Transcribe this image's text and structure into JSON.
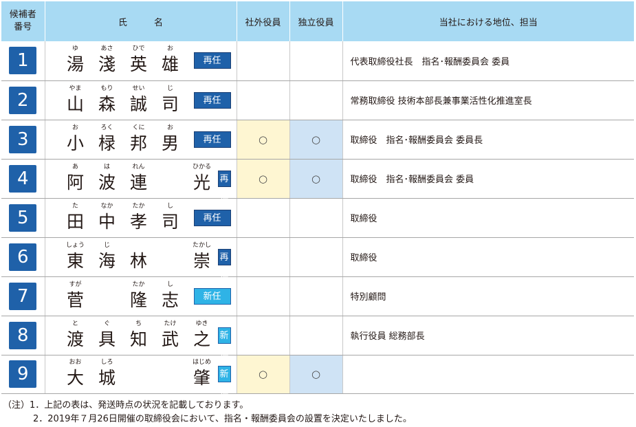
{
  "header": {
    "number_line1": "候補者",
    "number_line2": "番号",
    "name": "氏　　　名",
    "outside": "社外役員",
    "independent": "独立役員",
    "position": "当社における地位、担当"
  },
  "mark_symbol": "○",
  "colors": {
    "header_bg": "#a8daf3",
    "number_box": "#1f61a9",
    "badge_reappoint": "#1f61a9",
    "badge_new": "#2fb3e6",
    "outside_mark_bg": "#fef6d2",
    "independent_mark_bg": "#cfe3f5"
  },
  "candidates": [
    {
      "number": "1",
      "chars": [
        {
          "k": "湯",
          "r": "ゆ"
        },
        {
          "k": "淺",
          "r": "あさ"
        },
        {
          "k": "英",
          "r": "ひで"
        },
        {
          "k": "雄",
          "r": "お"
        }
      ],
      "badge": "再任",
      "badge_type": "re",
      "outside": false,
      "independent": false,
      "position": "代表取締役社長　指名･報酬委員会 委員"
    },
    {
      "number": "2",
      "chars": [
        {
          "k": "山",
          "r": "やま"
        },
        {
          "k": "森",
          "r": "もり"
        },
        {
          "k": "誠",
          "r": "せい"
        },
        {
          "k": "司",
          "r": "じ"
        }
      ],
      "badge": "再任",
      "badge_type": "re",
      "outside": false,
      "independent": false,
      "position": "常務取締役 技術本部長兼事業活性化推進室長"
    },
    {
      "number": "3",
      "chars": [
        {
          "k": "小",
          "r": "お"
        },
        {
          "k": "椂",
          "r": "ろく"
        },
        {
          "k": "邦",
          "r": "くに"
        },
        {
          "k": "男",
          "r": "お"
        }
      ],
      "badge": "再任",
      "badge_type": "re",
      "outside": true,
      "independent": true,
      "position": "取締役　指名･報酬委員会 委員長"
    },
    {
      "number": "4",
      "chars": [
        {
          "k": "阿",
          "r": "あ"
        },
        {
          "k": "波",
          "r": "は"
        },
        {
          "k": "連",
          "r": "れん"
        },
        {
          "k": "",
          "r": ""
        },
        {
          "k": "光",
          "r": "ひかる"
        }
      ],
      "badge": "再任",
      "badge_type": "re",
      "outside": true,
      "independent": true,
      "position": "取締役　指名･報酬委員会 委員"
    },
    {
      "number": "5",
      "chars": [
        {
          "k": "田",
          "r": "た"
        },
        {
          "k": "中",
          "r": "なか"
        },
        {
          "k": "孝",
          "r": "たか"
        },
        {
          "k": "司",
          "r": "し"
        }
      ],
      "badge": "再任",
      "badge_type": "re",
      "outside": false,
      "independent": false,
      "position": "取締役"
    },
    {
      "number": "6",
      "chars": [
        {
          "k": "東",
          "r": "しょう"
        },
        {
          "k": "海",
          "r": "じ"
        },
        {
          "k": "林",
          "r": ""
        },
        {
          "k": "",
          "r": ""
        },
        {
          "k": "崇",
          "r": "たかし"
        }
      ],
      "badge": "再任",
      "badge_type": "re",
      "outside": false,
      "independent": false,
      "position": "取締役"
    },
    {
      "number": "7",
      "chars": [
        {
          "k": "菅",
          "r": "すが"
        },
        {
          "k": "",
          "r": ""
        },
        {
          "k": "隆",
          "r": "たか"
        },
        {
          "k": "志",
          "r": "し"
        }
      ],
      "badge": "新任",
      "badge_type": "new",
      "outside": false,
      "independent": false,
      "position": "特別顧問"
    },
    {
      "number": "8",
      "chars": [
        {
          "k": "渡",
          "r": "と"
        },
        {
          "k": "具",
          "r": "ぐ"
        },
        {
          "k": "知",
          "r": "ち"
        },
        {
          "k": "武",
          "r": "たけ"
        },
        {
          "k": "之",
          "r": "ゆき"
        }
      ],
      "badge": "新任",
      "badge_type": "new",
      "outside": false,
      "independent": false,
      "position": "執行役員 総務部長"
    },
    {
      "number": "9",
      "chars": [
        {
          "k": "大",
          "r": "おお"
        },
        {
          "k": "城",
          "r": "しろ"
        },
        {
          "k": "",
          "r": ""
        },
        {
          "k": "",
          "r": ""
        },
        {
          "k": "肇",
          "r": "はじめ"
        }
      ],
      "badge": "新任",
      "badge_type": "new",
      "outside": true,
      "independent": true,
      "position": ""
    }
  ],
  "notes": {
    "line1": "（注）1．上記の表は、発送時点の状況を記載しております。",
    "line2": "2．2019年７月26日開催の取締役会において、指名・報酬委員会の設置を決定いたしました。"
  }
}
